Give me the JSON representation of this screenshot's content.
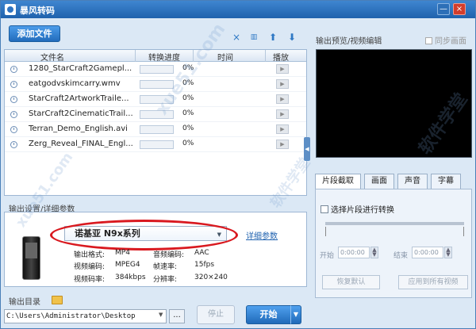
{
  "window": {
    "title": "暴风转码"
  },
  "toolbar": {
    "add_label": "添加文件",
    "delete_icon": "×",
    "clear_icon": "trash-icon",
    "up_icon": "⬆",
    "down_icon": "⬇"
  },
  "file_list": {
    "columns": [
      "文件名",
      "转换进度",
      "时间",
      "播放"
    ],
    "rows": [
      {
        "name": "1280_StarCraft2Gamepl...",
        "progress": "0%",
        "progress_value": 0
      },
      {
        "name": "eatgodvskimcarry.wmv",
        "progress": "0%",
        "progress_value": 0
      },
      {
        "name": "StarCraft2ArtworkTraile...",
        "progress": "0%",
        "progress_value": 0
      },
      {
        "name": "StarCraft2CinematicTrail...",
        "progress": "0%",
        "progress_value": 0
      },
      {
        "name": "Terran_Demo_English.avi",
        "progress": "0%",
        "progress_value": 0
      },
      {
        "name": "Zerg_Reveal_FINAL_Engl...",
        "progress": "0%",
        "progress_value": 0
      }
    ],
    "play_icon": "▶"
  },
  "preview": {
    "label": "输出预览/视频编辑",
    "sync_label": "同步画面"
  },
  "edit_tabs": [
    "片段截取",
    "画面",
    "声音",
    "字幕"
  ],
  "editor": {
    "checkbox_label": "选择片段进行转换",
    "start_label": "开始",
    "end_label": "结束",
    "start_time": "0:00:00",
    "end_time": "0:00:00",
    "reset_button": "恢复默认",
    "apply_button": "应用到所有视频"
  },
  "output": {
    "label": "输出设置/详细参数",
    "device": "诺基亚 N9x系列",
    "details_link": "详细参数",
    "params": [
      {
        "label": "输出格式:",
        "value": "MP4"
      },
      {
        "label": "音频编码:",
        "value": "AAC"
      },
      {
        "label": "视频编码:",
        "value": "MPEG4"
      },
      {
        "label": "帧速率:",
        "value": "15fps"
      },
      {
        "label": "视频码率:",
        "value": "384kbps"
      },
      {
        "label": "分辨率:",
        "value": "320×240"
      }
    ]
  },
  "directory": {
    "label": "输出目录",
    "path": "C:\\Users\\Administrator\\Desktop",
    "browse": "..."
  },
  "actions": {
    "stop": "停止",
    "start": "开始",
    "start_menu_icon": "▼"
  },
  "watermarks": [
    "xue51.com",
    "软件学堂",
    "xue51.com",
    "软件学堂"
  ]
}
